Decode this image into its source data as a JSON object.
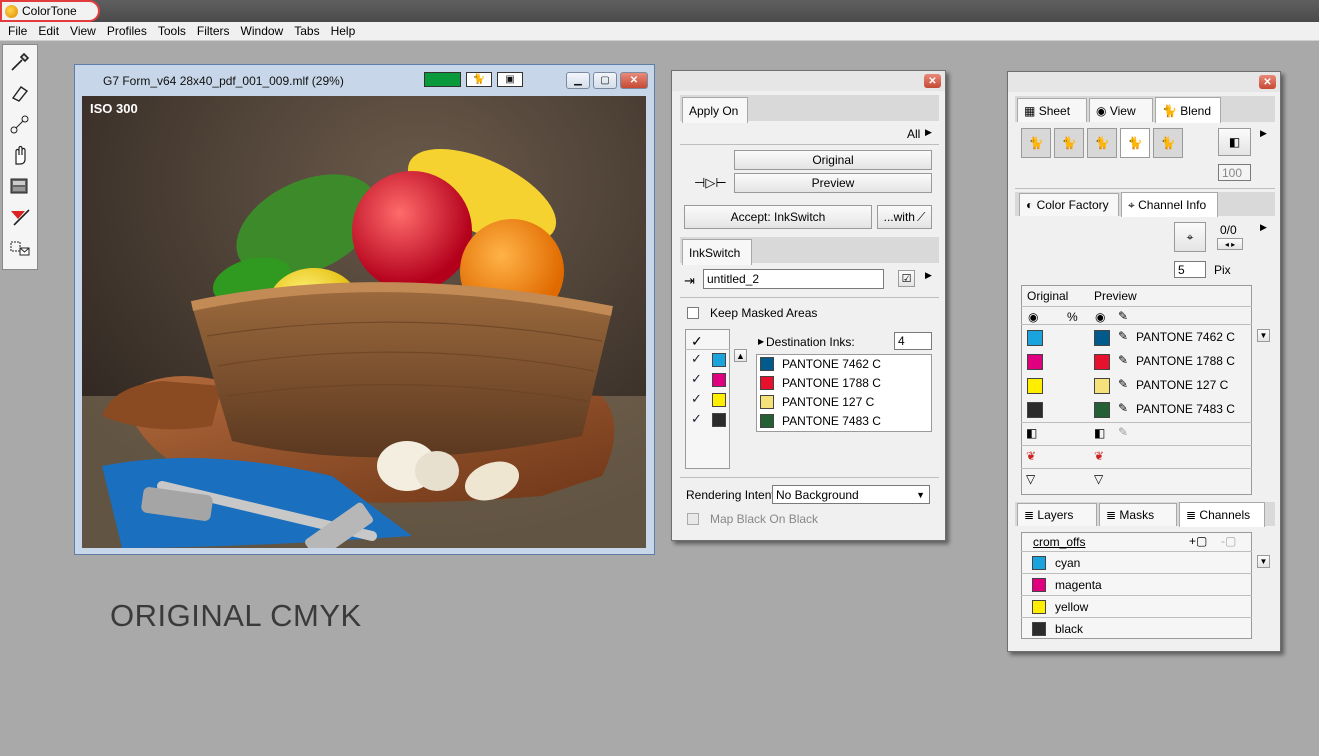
{
  "app": {
    "title": "ColorTone"
  },
  "menu": [
    "File",
    "Edit",
    "View",
    "Profiles",
    "Tools",
    "Filters",
    "Window",
    "Tabs",
    "Help"
  ],
  "document": {
    "title": "G7 Form_v64 28x40_pdf_001_009.mlf (29%)",
    "overlay_label": "ISO 300"
  },
  "caption": "ORIGINAL CMYK",
  "inkswitch_panel": {
    "tab_apply_on": "Apply On",
    "all_label": "All",
    "original_button": "Original",
    "preview_button": "Preview",
    "accept_button": "Accept: InkSwitch",
    "with_button": "...with",
    "tab_inkswitch": "InkSwitch",
    "name_value": "untitled_2",
    "keep_masked": "Keep Masked Areas",
    "destination_label": "Destination Inks:",
    "destination_count": "4",
    "source_colors": [
      "#1aa3dd",
      "#e0007f",
      "#ffee00",
      "#2b2b2b"
    ],
    "destination_inks": [
      {
        "name": "PANTONE 7462 C",
        "color": "#005a8c"
      },
      {
        "name": "PANTONE 1788 C",
        "color": "#e8112d"
      },
      {
        "name": "PANTONE 127 C",
        "color": "#f6e27a"
      },
      {
        "name": "PANTONE 7483 C",
        "color": "#255f36"
      }
    ],
    "rendering_label": "Rendering Intent",
    "rendering_value": "No Background",
    "map_black": "Map Black On Black"
  },
  "right_panel": {
    "tabs_top": [
      "Sheet",
      "View",
      "Blend"
    ],
    "blend_value": "100",
    "tabs_mid": [
      "Color Factory",
      "Channel Info"
    ],
    "pos_value": "0/0",
    "pix_value": "5",
    "pix_label": "Pix",
    "original_header": "Original",
    "preview_header": "Preview",
    "percent_symbol": "%",
    "original_colors": [
      "#1aa3dd",
      "#e0007f",
      "#ffee00",
      "#2b2b2b"
    ],
    "preview_inks": [
      {
        "name": "PANTONE 7462 C",
        "color": "#005a8c"
      },
      {
        "name": "PANTONE 1788 C",
        "color": "#e8112d"
      },
      {
        "name": "PANTONE 127 C",
        "color": "#f6e27a"
      },
      {
        "name": "PANTONE 7483 C",
        "color": "#255f36"
      }
    ],
    "tabs_bottom": [
      "Layers",
      "Masks",
      "Channels"
    ],
    "channel_set": "crom_offs",
    "channels": [
      {
        "name": "cyan",
        "color": "#1aa3dd"
      },
      {
        "name": "magenta",
        "color": "#e0007f"
      },
      {
        "name": "yellow",
        "color": "#ffee00"
      },
      {
        "name": "black",
        "color": "#2b2b2b"
      }
    ]
  }
}
